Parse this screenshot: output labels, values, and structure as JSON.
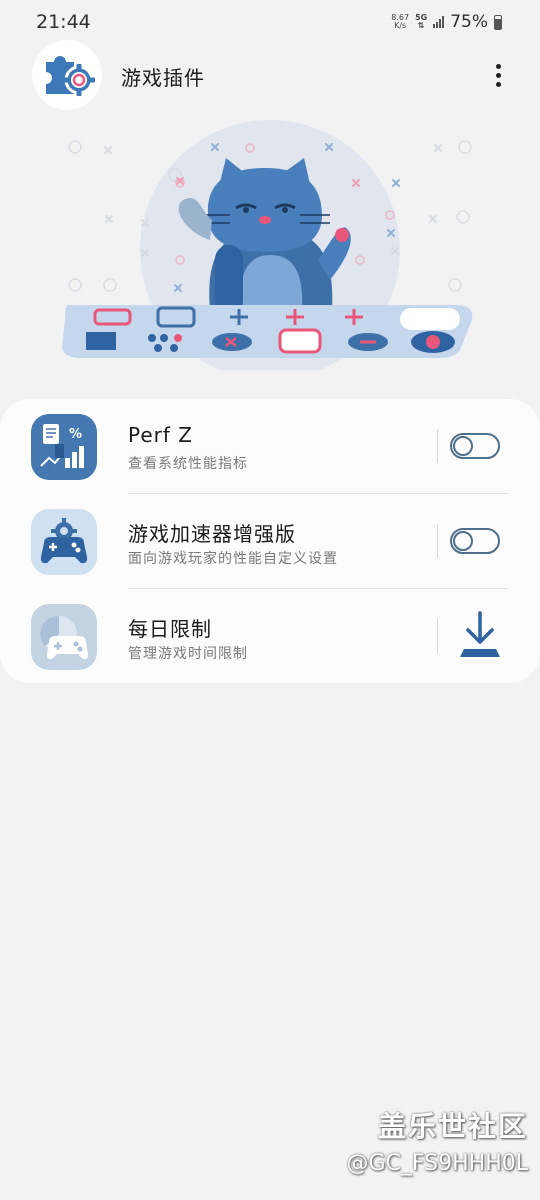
{
  "status_bar": {
    "time": "21:44",
    "net_speed_value": "8.67",
    "net_speed_unit": "K/s",
    "network_type": "5G",
    "battery": "75%"
  },
  "header": {
    "title": "游戏插件",
    "logo_icon": "puzzle-gear-icon",
    "menu_icon": "more-vertical-icon"
  },
  "plugins": [
    {
      "title": "Perf Z",
      "subtitle": "查看系统性能指标",
      "control": "toggle",
      "enabled": false,
      "icon": "perf-chart-icon"
    },
    {
      "title": "游戏加速器增强版",
      "subtitle": "面向游戏玩家的性能自定义设置",
      "control": "toggle",
      "enabled": false,
      "icon": "gamepad-gear-icon"
    },
    {
      "title": "每日限制",
      "subtitle": "管理游戏时间限制",
      "control": "download",
      "icon": "gamepad-timer-icon"
    }
  ],
  "watermark": {
    "brand": "盖乐世社区",
    "user": "@GC_FS9HHH0L"
  },
  "colors": {
    "accent": "#3d79b8",
    "pink": "#e8577a",
    "background": "#f2f2f2",
    "card": "#fcfcfc"
  }
}
